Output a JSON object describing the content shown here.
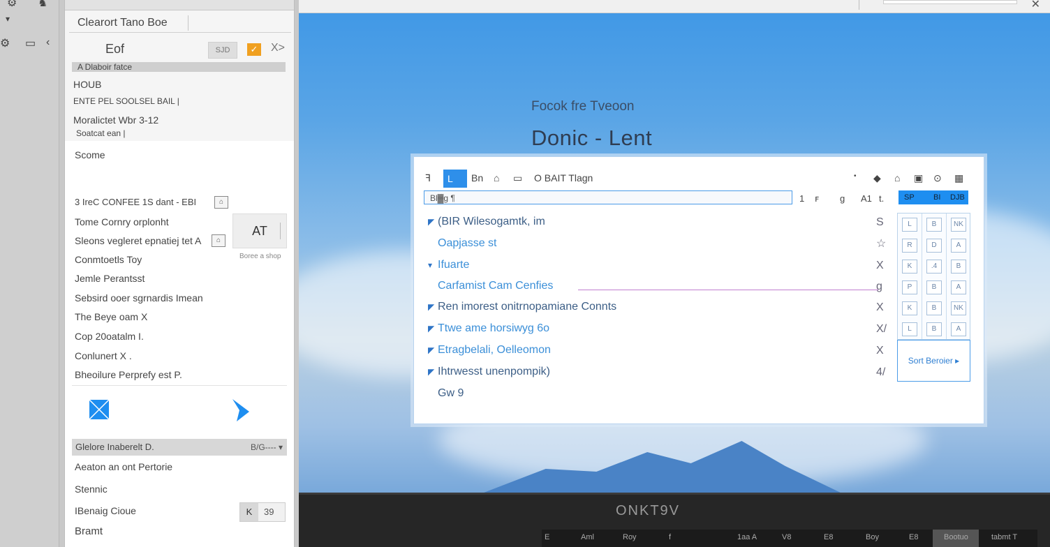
{
  "rail": {
    "icons": [
      "tools-icon",
      "folder-icon",
      "chevron-left-icon"
    ]
  },
  "panel": {
    "title": "Clearort Tano Boe",
    "subhead": "Eof",
    "subtools": {
      "b1": "SJD",
      "b2": "✓",
      "b3": "X>"
    },
    "graybar": "A Dlaboir fatce",
    "lines": [
      "HOUB",
      "ENTE PEL SOOLSEL BAIL |",
      "Moralictet Wbr  3-12",
      "Soatcat ean |"
    ],
    "list_head": "Scome",
    "list": [
      "3 IreC CONFEE 1S dant -    EBI",
      "Tome Cornry orplonht",
      "Sleons vegleret epnatiej tet A",
      "Conmtoetls Toy",
      "Jemle Perantsst",
      "Sebsird ooer sgrnardis Imean",
      "The Beye oam X",
      "Cop 20oatalm I.",
      "Conlunert X .",
      "Bheoilure Perprefy est P."
    ],
    "at_box": "AT",
    "at_caption": "Boree a shop",
    "bottombar": {
      "label": "Glelore Inaberelt D.",
      "right": "B/G---- ▾"
    },
    "footer_items": [
      "Aeaton an ont Pertorie",
      "Stennic",
      "IBenaig Cioue",
      "Bramt"
    ],
    "pill": {
      "left": "K",
      "right": "39"
    }
  },
  "main": {
    "subtitle": "Focok fre Tveoon",
    "title": "Donic  -  Lent",
    "card": {
      "toolbar": {
        "items": [
          "ꟻ",
          "L",
          "Bn",
          "⌂",
          "▭",
          "O BAIT  Tlagn"
        ],
        "right_icons": [
          "•",
          "◆",
          "⌂",
          "▣",
          "⊙",
          "▦"
        ]
      },
      "input": "Bl▓g ¶",
      "small_tools": [
        "1",
        "ꜰ",
        "g",
        "A1",
        "t."
      ],
      "bluebar": [
        "SP",
        "BI",
        "DJB"
      ],
      "rows": [
        {
          "text": "(BIR Wilesogamtk, im",
          "tri": "◤",
          "action": "S"
        },
        {
          "text": "Oapjasse st",
          "tri": "",
          "action": "☆"
        },
        {
          "text": "Ifuarte",
          "tri": "▾",
          "action": "X"
        },
        {
          "text": "Carfamist Cam Cenfies",
          "tri": "",
          "action": "g"
        },
        {
          "text": "Ren imorest onitrnopamiane Connts",
          "tri": "◤",
          "action": "X"
        },
        {
          "text": "Ttwe ame horsiwyg 6o",
          "tri": "◤",
          "action": "X/"
        },
        {
          "text": "Etragbelali, Oelleomon",
          "tri": "◤",
          "action": "X"
        },
        {
          "text": "Ihtrwesst unenpompik)",
          "tri": "◤",
          "action": "4/"
        },
        {
          "text": "Gw 9",
          "tri": "",
          "action": ""
        }
      ],
      "grid": [
        "L",
        "B",
        "NK",
        "R",
        "D",
        "A",
        "K",
        ".4",
        "B",
        "P",
        "B",
        "A",
        "K",
        "B",
        "NK",
        "L",
        "B",
        "A"
      ],
      "sort": "Sort Beroier ▸"
    },
    "dock": {
      "brand": "ONKT9V",
      "strip": [
        "E",
        "Aml",
        "Roy",
        "f",
        "1aa A",
        "V8",
        "E8",
        "Boy",
        "E8",
        "Bootuo",
        "tabmt T"
      ]
    }
  }
}
